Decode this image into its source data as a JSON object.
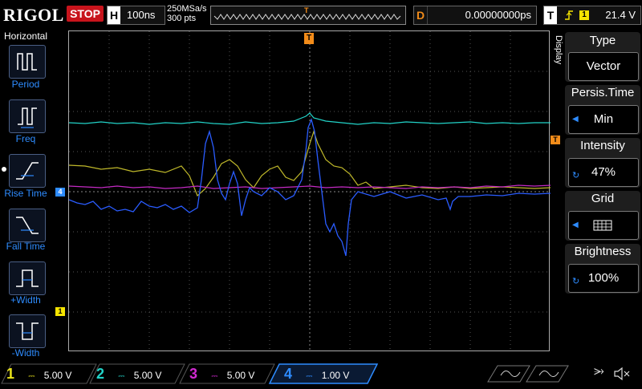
{
  "brand": "RIGOL",
  "run_state": "STOP",
  "horizontal": {
    "label": "H",
    "timebase": "100ns",
    "sample_rate": "250MSa/s",
    "points": "300 pts"
  },
  "delay": {
    "label": "D",
    "value": "0.00000000ps"
  },
  "trigger": {
    "label": "T",
    "source": "1",
    "level": "21.4 V",
    "marker": "T"
  },
  "left_menu": {
    "title": "Horizontal",
    "items": [
      {
        "label": "Period"
      },
      {
        "label": "Freq"
      },
      {
        "label": "Rise Time",
        "selected": true
      },
      {
        "label": "Fall Time"
      },
      {
        "label": "+Width"
      },
      {
        "label": "-Width"
      }
    ]
  },
  "right_menu": {
    "tab": "Display",
    "type": {
      "label": "Type",
      "value": "Vector"
    },
    "persis_time": {
      "label": "Persis.Time",
      "value": "Min"
    },
    "intensity": {
      "label": "Intensity",
      "value": "47%"
    },
    "grid": {
      "label": "Grid",
      "value_icon": "grid-icon"
    },
    "brightness": {
      "label": "Brightness",
      "value": "100%"
    }
  },
  "channels": [
    {
      "num": "1",
      "scale": "5.00 V",
      "color": "#e8e21a"
    },
    {
      "num": "2",
      "scale": "5.00 V",
      "color": "#22d3c8"
    },
    {
      "num": "3",
      "scale": "5.00 V",
      "color": "#d22ad2"
    },
    {
      "num": "4",
      "scale": "1.00 V",
      "color": "#1f6eff"
    }
  ],
  "markers": {
    "ch4": "4",
    "ch1": "1"
  },
  "colors": {
    "run_stop": "#c8141c",
    "accent": "#2e8cff",
    "trigger": "#f28c1a"
  }
}
